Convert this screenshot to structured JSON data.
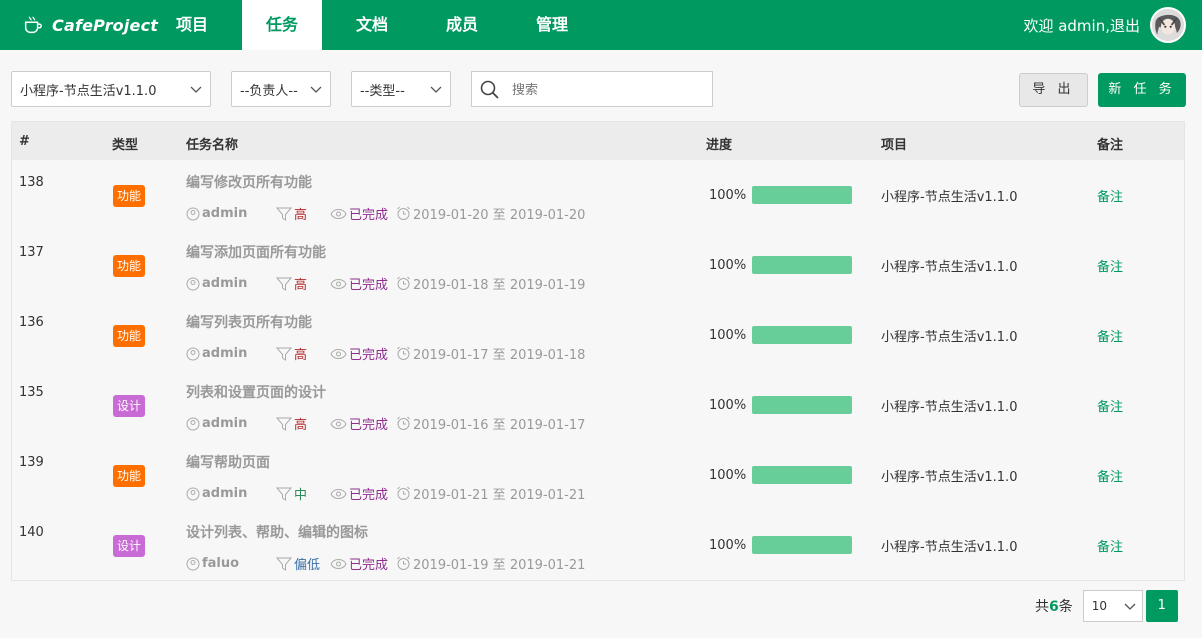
{
  "header": {
    "brand": "CafeProject",
    "nav": [
      "项目",
      "任务",
      "文档",
      "成员",
      "管理"
    ],
    "welcome": "欢迎 admin,退出"
  },
  "filters": {
    "project": "小程序-节点生活v1.1.0",
    "assignee": "--负责人--",
    "type": "--类型--",
    "search_placeholder": "搜索",
    "export_label": "导 出",
    "new_label": "新 任 务"
  },
  "table": {
    "columns": {
      "id": "#",
      "type": "类型",
      "name": "任务名称",
      "progress": "进度",
      "project": "项目",
      "note": "备注"
    },
    "rows": [
      {
        "id": "138",
        "type": "功能",
        "type_kind": "func",
        "name": "编写修改页所有功能",
        "user": "admin",
        "priority": "高",
        "pri_kind": "high",
        "status": "已完成",
        "date": "2019-01-20 至 2019-01-20",
        "progress": "100%",
        "progress_value": 1.0,
        "project": "小程序-节点生活v1.1.0",
        "note": "备注"
      },
      {
        "id": "137",
        "type": "功能",
        "type_kind": "func",
        "name": "编写添加页面所有功能",
        "user": "admin",
        "priority": "高",
        "pri_kind": "high",
        "status": "已完成",
        "date": "2019-01-18 至 2019-01-19",
        "progress": "100%",
        "progress_value": 1.0,
        "project": "小程序-节点生活v1.1.0",
        "note": "备注"
      },
      {
        "id": "136",
        "type": "功能",
        "type_kind": "func",
        "name": "编写列表页所有功能",
        "user": "admin",
        "priority": "高",
        "pri_kind": "high",
        "status": "已完成",
        "date": "2019-01-17 至 2019-01-18",
        "progress": "100%",
        "progress_value": 1.0,
        "project": "小程序-节点生活v1.1.0",
        "note": "备注"
      },
      {
        "id": "135",
        "type": "设计",
        "type_kind": "design",
        "name": "列表和设置页面的设计",
        "user": "admin",
        "priority": "高",
        "pri_kind": "high",
        "status": "已完成",
        "date": "2019-01-16 至 2019-01-17",
        "progress": "100%",
        "progress_value": 1.0,
        "project": "小程序-节点生活v1.1.0",
        "note": "备注"
      },
      {
        "id": "139",
        "type": "功能",
        "type_kind": "func",
        "name": "编写帮助页面",
        "user": "admin",
        "priority": "中",
        "pri_kind": "mid",
        "status": "已完成",
        "date": "2019-01-21 至 2019-01-21",
        "progress": "100%",
        "progress_value": 1.0,
        "project": "小程序-节点生活v1.1.0",
        "note": "备注"
      },
      {
        "id": "140",
        "type": "设计",
        "type_kind": "design",
        "name": "设计列表、帮助、编辑的图标",
        "user": "faluo",
        "priority": "偏低",
        "pri_kind": "low",
        "status": "已完成",
        "date": "2019-01-19 至 2019-01-21",
        "progress": "100%",
        "progress_value": 1.0,
        "project": "小程序-节点生活v1.1.0",
        "note": "备注"
      }
    ]
  },
  "pager": {
    "total_prefix": "共",
    "total_count": "6",
    "total_suffix": "条",
    "page_size": "10",
    "current_page": "1"
  },
  "colors": {
    "brand": "#009a61",
    "func_tag": "#ff6f00",
    "design_tag": "#c86bd4",
    "progress": "#67cd99"
  }
}
